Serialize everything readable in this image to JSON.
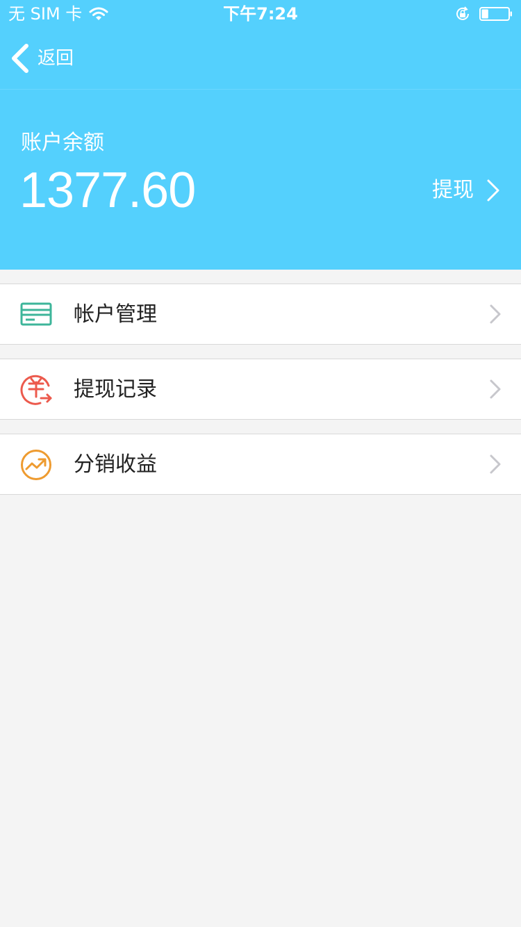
{
  "status_bar": {
    "carrier": "无 SIM 卡",
    "time": "下午7:24",
    "battery_level": 0.25
  },
  "nav": {
    "back_label": "返回"
  },
  "account": {
    "balance_label": "账户余额",
    "balance_amount": "1377.60",
    "withdraw_label": "提现"
  },
  "menu": {
    "items": [
      {
        "label": "帐户管理",
        "icon": "card-icon",
        "color": "#3db59a"
      },
      {
        "label": "提现记录",
        "icon": "yuan-transfer-icon",
        "color": "#ec5a4d"
      },
      {
        "label": "分销收益",
        "icon": "trend-up-icon",
        "color": "#ee9b30"
      }
    ]
  },
  "colors": {
    "header_bg": "#54d0fd",
    "page_bg": "#f4f4f4",
    "chevron": "#c7c7cc"
  }
}
